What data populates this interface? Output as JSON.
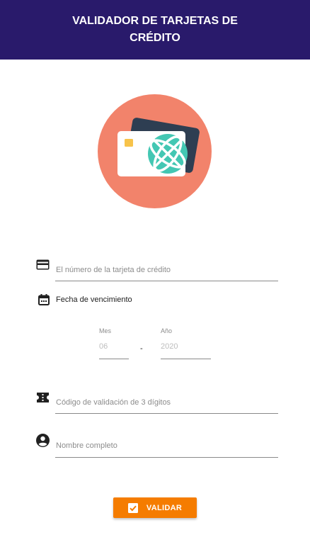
{
  "header": {
    "title": "VALIDADOR DE TARJETAS DE CRÉDITO"
  },
  "colors": {
    "header_bg": "#291a6b",
    "accent": "#f57c00",
    "illustration_circle": "#f2836b"
  },
  "form": {
    "card_number": {
      "icon": "credit-card-icon",
      "placeholder": "El número de la tarjeta de crédito"
    },
    "expiry": {
      "icon": "calendar-icon",
      "label": "Fecha de vencimiento",
      "month_label": "Mes",
      "month_value": "06",
      "separator": "-",
      "year_label": "Año",
      "year_value": "2020"
    },
    "cvv": {
      "icon": "ticket-icon",
      "placeholder": "Código de validación de 3 dígitos"
    },
    "full_name": {
      "icon": "account-circle-icon",
      "placeholder": "Nombre completo"
    }
  },
  "submit": {
    "icon": "checkbox-icon",
    "label": "VALIDAR"
  }
}
